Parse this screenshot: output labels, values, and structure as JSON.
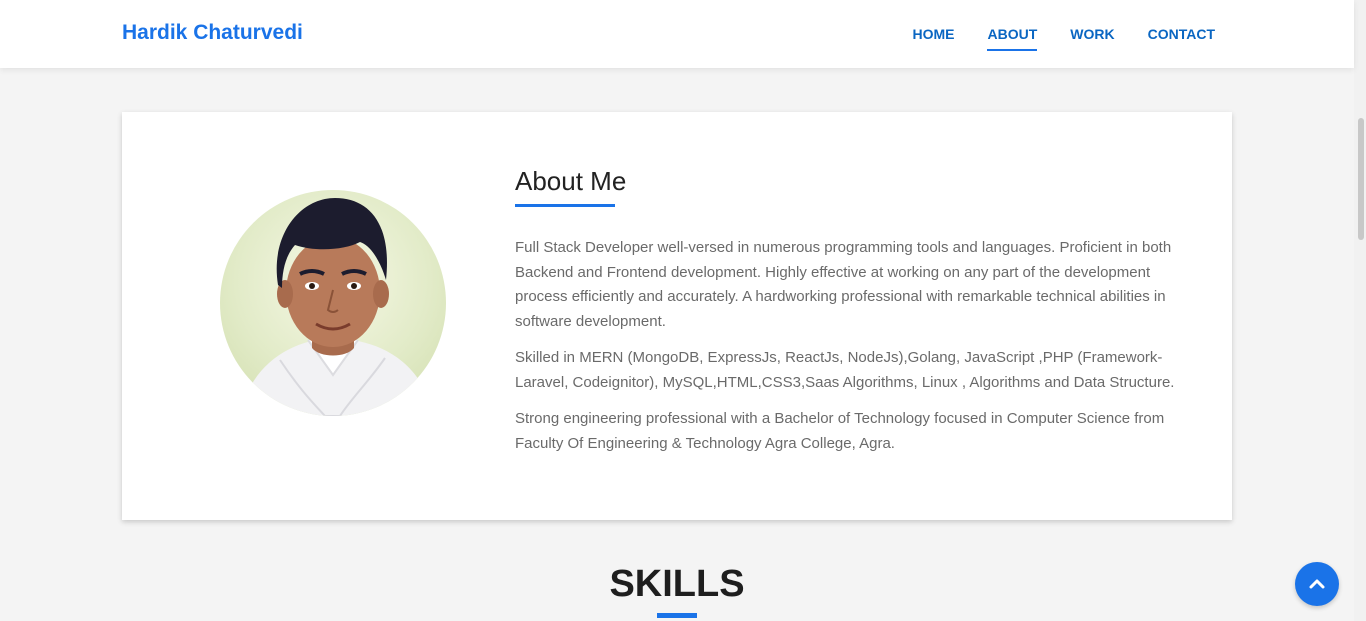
{
  "nav": {
    "brand": "Hardik Chaturvedi",
    "links": [
      "HOME",
      "ABOUT",
      "WORK",
      "CONTACT"
    ],
    "active": "ABOUT"
  },
  "about": {
    "title": "About Me",
    "paragraphs": [
      "Full Stack Developer well-versed in numerous programming tools and languages. Proficient in both Backend and Frontend development. Highly effective at working on any part of the development process efficiently and accurately. A hardworking professional with remarkable technical abilities in software development.",
      "Skilled in MERN (MongoDB, ExpressJs, ReactJs, NodeJs),Golang, JavaScript ,PHP (Framework-Laravel, Codeignitor), MySQL,HTML,CSS3,Saas Algorithms, Linux , Algorithms and Data Structure.",
      "Strong engineering professional with a Bachelor of Technology focused in Computer Science from Faculty Of Engineering & Technology Agra College, Agra."
    ]
  },
  "skills": {
    "title": "SKILLS"
  },
  "icons": {
    "scroll_top": "chevron-up-icon",
    "avatar": "profile-photo"
  },
  "colors": {
    "accent": "#1a73e8",
    "nav_link": "#0a66c2",
    "background": "#f4f4f4",
    "body_text": "#6a6a6a"
  }
}
